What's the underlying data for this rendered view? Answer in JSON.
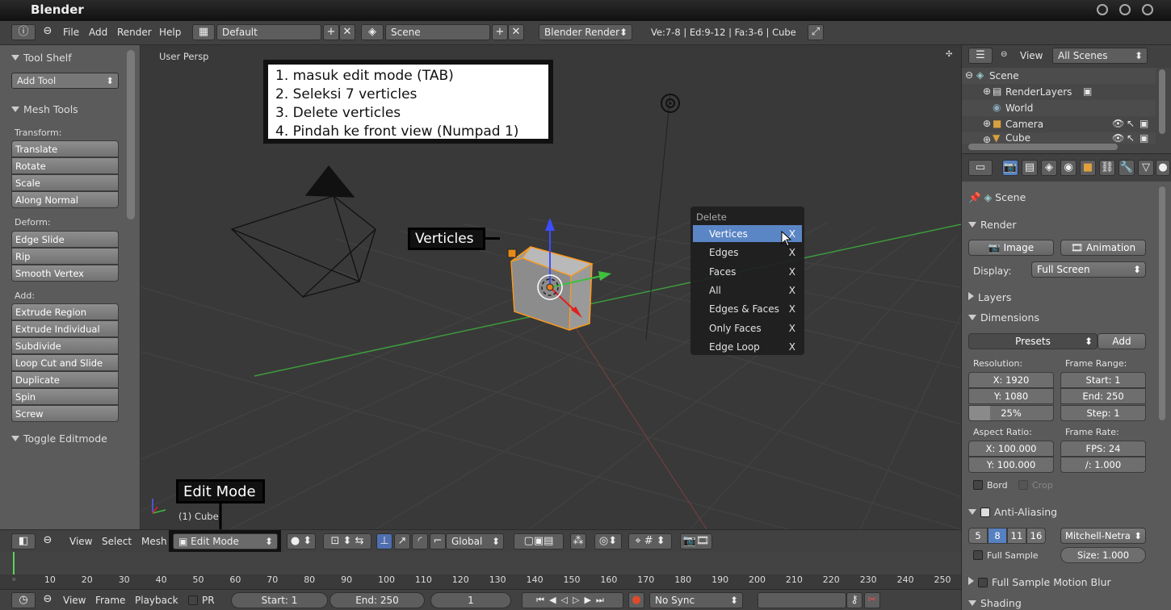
{
  "window": {
    "title": "Blender"
  },
  "topbar": {
    "menus": [
      "File",
      "Add",
      "Render",
      "Help"
    ],
    "screen_layout": "Default",
    "scene": "Scene",
    "render_engine": "Blender Render",
    "stats": "Ve:7-8 | Ed:9-12 | Fa:3-6 | Cube"
  },
  "toolshelf": {
    "title": "Tool Shelf",
    "add_tool": "Add Tool",
    "mesh_tools": "Mesh Tools",
    "transform_label": "Transform:",
    "transform": [
      "Translate",
      "Rotate",
      "Scale",
      "Along Normal"
    ],
    "deform_label": "Deform:",
    "deform": [
      "Edge Slide",
      "Rip",
      "Smooth Vertex"
    ],
    "add_label": "Add:",
    "add": [
      "Extrude Region",
      "Extrude Individual",
      "Subdivide",
      "Loop Cut and Slide",
      "Duplicate",
      "Spin",
      "Screw"
    ],
    "toggle_editmode": "Toggle Editmode"
  },
  "viewport": {
    "view_label": "User Persp",
    "object_label": "(1) Cube",
    "instructions": [
      "1. masuk edit mode (TAB)",
      "2. Seleksi 7 verticles",
      "3. Delete verticles",
      "4. Pindah ke front view (Numpad 1)"
    ],
    "verticles_callout": "Verticles",
    "editmode_callout": "Edit Mode"
  },
  "delete_menu": {
    "title": "Delete",
    "items": [
      {
        "label": "Vertices",
        "key": "X"
      },
      {
        "label": "Edges",
        "key": "X"
      },
      {
        "label": "Faces",
        "key": "X"
      },
      {
        "label": "All",
        "key": "X"
      },
      {
        "label": "Edges & Faces",
        "key": "X"
      },
      {
        "label": "Only Faces",
        "key": "X"
      },
      {
        "label": "Edge Loop",
        "key": "X"
      }
    ]
  },
  "viewport_header": {
    "menus": [
      "View",
      "Select",
      "Mesh"
    ],
    "mode": "Edit Mode",
    "orientation": "Global"
  },
  "timeline": {
    "ticks": [
      "0",
      "10",
      "20",
      "30",
      "40",
      "50",
      "60",
      "70",
      "80",
      "90",
      "100",
      "110",
      "120",
      "130",
      "140",
      "150",
      "160",
      "170",
      "180",
      "190",
      "200",
      "210",
      "220",
      "230",
      "240",
      "250"
    ],
    "menus": [
      "View",
      "Frame",
      "Playback"
    ],
    "pr": "PR",
    "start": "Start: 1",
    "end": "End: 250",
    "current": "1",
    "sync": "No Sync"
  },
  "outliner": {
    "view": "View",
    "filter": "All Scenes",
    "items": [
      "Scene",
      "RenderLayers",
      "World",
      "Camera",
      "Cube"
    ]
  },
  "properties": {
    "context": "Scene",
    "render_header": "Render",
    "image_btn": "Image",
    "animation_btn": "Animation",
    "display_label": "Display:",
    "display_value": "Full Screen",
    "layers_header": "Layers",
    "dimensions_header": "Dimensions",
    "presets": "Presets",
    "add": "Add",
    "resolution_label": "Resolution:",
    "res_x": "X: 1920",
    "res_y": "Y: 1080",
    "res_pct": "25%",
    "frame_range_label": "Frame Range:",
    "start": "Start: 1",
    "end": "End: 250",
    "step": "Step: 1",
    "aspect_label": "Aspect Ratio:",
    "aspect_x": "X: 100.000",
    "aspect_y": "Y: 100.000",
    "frame_rate_label": "Frame Rate:",
    "fps": "FPS: 24",
    "fps_base": "/: 1.000",
    "bord": "Bord",
    "crop": "Crop",
    "aa_header": "Anti-Aliasing",
    "aa_samples": [
      "5",
      "8",
      "11",
      "16"
    ],
    "aa_filter": "Mitchell-Netra",
    "full_sample": "Full Sample",
    "size": "Size: 1.000",
    "motion_blur": "Full Sample Motion Blur",
    "shading": "Shading"
  }
}
